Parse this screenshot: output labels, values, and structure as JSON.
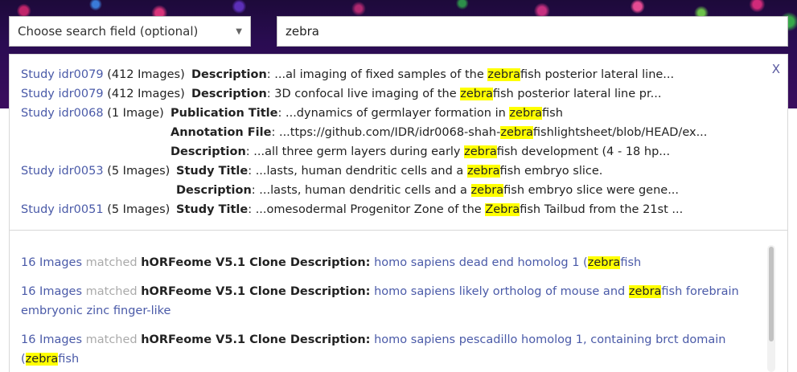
{
  "search_field": {
    "label": "Choose search field (optional)",
    "arrow": "▼"
  },
  "search": {
    "value": "zebra"
  },
  "studies": {
    "close": "X",
    "rows": [
      {
        "study": "Study idr0079",
        "count": "(412 Images)",
        "field": "Description",
        "pre": "...al imaging of fixed samples of the ",
        "hit": "zebra",
        "post": "fish posterior lateral line..."
      },
      {
        "study": "Study idr0079",
        "count": "(412 Images)",
        "field": "Description",
        "pre": "3D confocal live imaging of the ",
        "hit": "zebra",
        "post": "fish posterior lateral line pr..."
      },
      {
        "study": "Study idr0068",
        "count": "(1 Image)",
        "field": "Publication Title",
        "pre": "...dynamics of germlayer formation in ",
        "hit": "zebra",
        "post": "fish"
      },
      {
        "study": "",
        "count": "",
        "field": "Annotation File",
        "pre": "...ttps://github.com/IDR/idr0068-shah-",
        "hit": "zebra",
        "post": "fishlightsheet/blob/HEAD/ex..."
      },
      {
        "study": "",
        "count": "",
        "field": "Description",
        "pre": "...all three germ layers during early ",
        "hit": "zebra",
        "post": "fish development (4 - 18 hp..."
      },
      {
        "study": "Study idr0053",
        "count": "(5 Images)",
        "field": "Study Title",
        "pre": "...lasts, human dendritic cells and a ",
        "hit": "zebra",
        "post": "fish embryo slice."
      },
      {
        "study": "",
        "count": "",
        "field": "Description",
        "pre": "...lasts, human dendritic cells and a ",
        "hit": "zebra",
        "post": "fish embryo slice were gene..."
      },
      {
        "study": "Study idr0051",
        "count": "(5 Images)",
        "field": "Study Title",
        "pre": "...omesodermal Progenitor Zone of the ",
        "hit": "Zebra",
        "post": "fish Tailbud from the 21st ..."
      }
    ]
  },
  "results": [
    {
      "count": "16 Images",
      "matched": "matched",
      "key": "hORFeome V5.1 Clone Description:",
      "pre": "homo sapiens dead end homolog 1 (",
      "hit": "zebra",
      "post": "fish"
    },
    {
      "count": "16 Images",
      "matched": "matched",
      "key": "hORFeome V5.1 Clone Description:",
      "pre": "homo sapiens likely ortholog of mouse and ",
      "hit": "zebra",
      "post": "fish forebrain embryonic zinc finger-like"
    },
    {
      "count": "16 Images",
      "matched": "matched",
      "key": "hORFeome V5.1 Clone Description:",
      "pre": "homo sapiens pescadillo homolog 1, containing brct domain (",
      "hit": "zebra",
      "post": "fish"
    }
  ]
}
